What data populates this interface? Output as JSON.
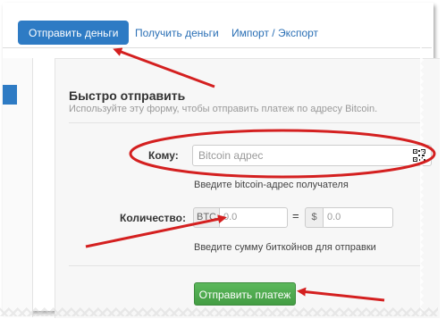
{
  "tabs": {
    "send": "Отправить деньги",
    "receive": "Получить деньги",
    "import_export": "Импорт / Экспорт"
  },
  "quick_send": {
    "title": "Быстро отправить",
    "description": "Используйте эту форму, чтобы отправить платеж по адресу Bitcoin."
  },
  "form": {
    "to_label": "Кому:",
    "address_placeholder": "Bitcoin адрес",
    "address_help": "Введите bitcoin-адрес получателя",
    "amount_label": "Количество:",
    "btc_addon": "BTC",
    "btc_value": "0.0",
    "equals": "=",
    "usd_addon": "$",
    "usd_value": "0.0",
    "amount_help": "Введите сумму биткойнов для отправки",
    "send_button": "Отправить платеж"
  },
  "colors": {
    "accent": "#2e7bc4",
    "send_button": "#5cb85c",
    "annotation": "#d42020"
  },
  "icons": {
    "qr": "qr-code-icon"
  }
}
